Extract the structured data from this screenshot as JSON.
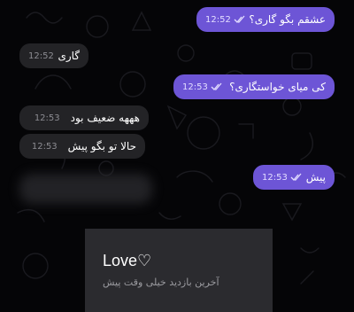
{
  "colors": {
    "outgoing_bubble": "#6d55d6",
    "incoming_bubble": "#232326",
    "background": "#050507"
  },
  "messages": [
    {
      "direction": "outgoing",
      "text": "عشقم بگو گاری؟",
      "time": "12:52",
      "status_icon": "double-check-icon"
    },
    {
      "direction": "incoming",
      "text": "گاری",
      "time": "12:52"
    },
    {
      "direction": "outgoing",
      "text": "کی میای خواستگاری؟",
      "time": "12:53",
      "status_icon": "double-check-icon"
    },
    {
      "direction": "incoming",
      "text": "هههه ضعیف بود",
      "time": "12:53"
    },
    {
      "direction": "incoming",
      "text": "حالا تو بگو پیش",
      "time": "12:53"
    },
    {
      "direction": "outgoing",
      "text": "پیش",
      "time": "12:53",
      "status_icon": "double-check-icon"
    }
  ],
  "profile": {
    "name": "Love♡",
    "status": "آخرین بازدید خیلی وقت پیش"
  }
}
